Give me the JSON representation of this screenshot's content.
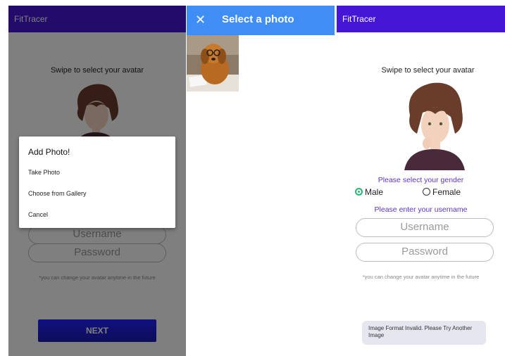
{
  "panel1": {
    "app_title": "FitTracer",
    "swipe_caption": "Swipe to select your avatar",
    "username_placeholder": "Username",
    "password_placeholder": "Password",
    "avatar_note": "*you can change your avatar anytime in the future",
    "next_label": "NEXT",
    "dialog": {
      "title": "Add Photo!",
      "items": [
        "Take Photo",
        "Choose from Gallery",
        "Cancel"
      ]
    }
  },
  "panel2": {
    "close_glyph": "✕",
    "title": "Select a photo"
  },
  "panel3": {
    "app_title": "FitTracer",
    "swipe_caption": "Swipe to select your avatar",
    "gender_prompt": "Please select your gender",
    "gender_options": [
      "Male",
      "Female"
    ],
    "gender_selected": "Male",
    "username_prompt": "Please enter your username",
    "username_placeholder": "Username",
    "password_placeholder": "Password",
    "avatar_note": "*you can change your avatar anytime in the future",
    "toast": "Image Format Invalid. Please Try Another Image"
  },
  "colors": {
    "app_bar": "#4616d6",
    "picker_bar": "#3e8ef5",
    "accent_text": "#5b33c8",
    "radio_selected": "#2bb673",
    "next_button": "#2222ff"
  },
  "icons": {
    "close": "close-icon",
    "avatar": "avatar-illustration",
    "photo": "dog-photo-thumbnail"
  }
}
